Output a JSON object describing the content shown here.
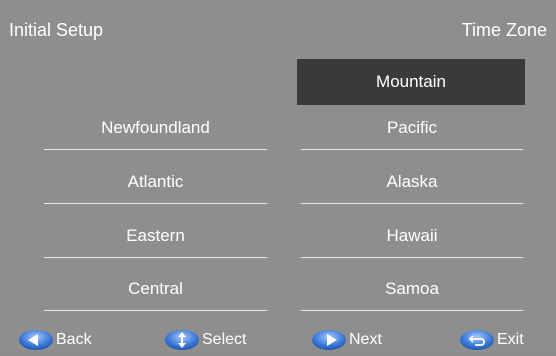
{
  "header": {
    "title": "Initial Setup",
    "section": "Time Zone"
  },
  "time_zones": {
    "left_column": [
      "Newfoundland",
      "Atlantic",
      "Eastern",
      "Central"
    ],
    "right_column": [
      "Mountain",
      "Pacific",
      "Alaska",
      "Hawaii",
      "Samoa"
    ],
    "selected": "Mountain"
  },
  "footer": {
    "back_label": "Back",
    "select_label": "Select",
    "next_label": "Next",
    "exit_label": "Exit",
    "icons": {
      "back": "left-arrow-icon",
      "select": "up-down-arrow-icon",
      "next": "right-arrow-icon",
      "exit": "return-icon"
    }
  },
  "colors": {
    "background": "#8e8e8e",
    "selected_bg": "#3a3a3a",
    "text": "#ffffff",
    "button_blue": "#2f6fc9"
  }
}
